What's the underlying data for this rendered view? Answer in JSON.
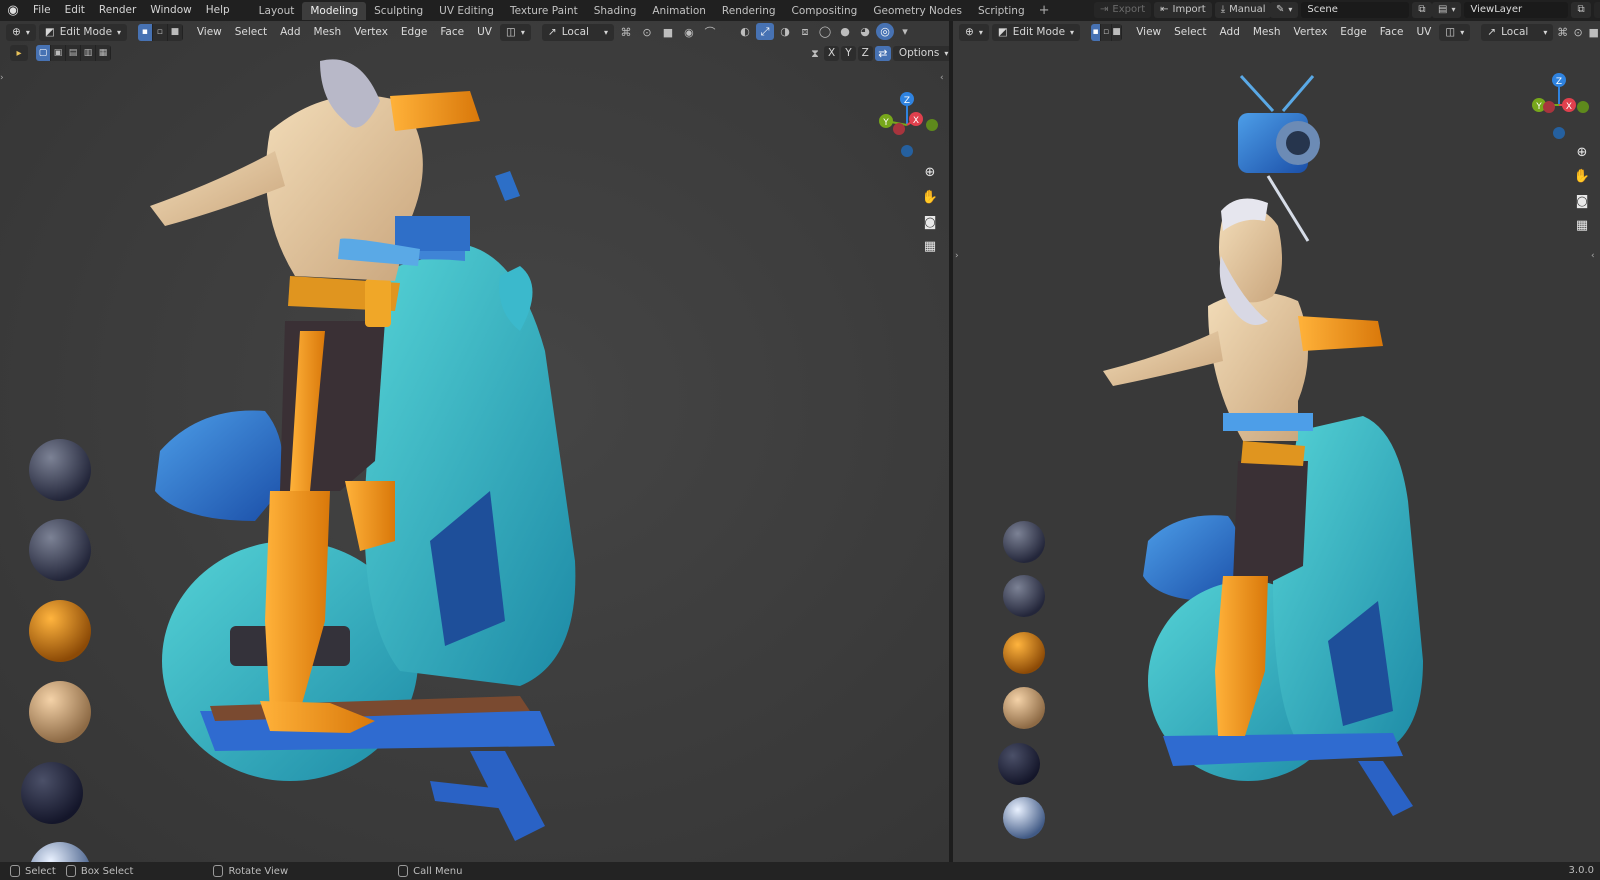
{
  "menu": [
    "File",
    "Edit",
    "Render",
    "Window",
    "Help"
  ],
  "workspaces": [
    "Layout",
    "Modeling",
    "Sculpting",
    "UV Editing",
    "Texture Paint",
    "Shading",
    "Animation",
    "Rendering",
    "Compositing",
    "Geometry Nodes",
    "Scripting"
  ],
  "active_workspace": "Modeling",
  "topbar": {
    "export": "Export",
    "import": "Import",
    "manual": "Manual",
    "scene": "Scene",
    "view_layer": "ViewLayer"
  },
  "left_view": {
    "mode": "Edit Mode",
    "menus": [
      "View",
      "Select",
      "Add",
      "Mesh",
      "Vertex",
      "Edge",
      "Face",
      "UV"
    ],
    "orientation": "Local",
    "axes": [
      "X",
      "Y",
      "Z"
    ],
    "options": "Options"
  },
  "right_view": {
    "mode": "Edit Mode",
    "menus": [
      "View",
      "Select",
      "Add",
      "Mesh",
      "Vertex",
      "Edge",
      "Face",
      "UV"
    ],
    "orientation": "Local"
  },
  "gizmo": {
    "z": "Z",
    "y": "Y",
    "x": "X"
  },
  "status": {
    "select": "Select",
    "box_select": "Box Select",
    "rotate_view": "Rotate View",
    "call_menu": "Call Menu",
    "version": "3.0.0"
  },
  "colors": {
    "accent": "#4772b3",
    "viewport_bg": "#3a3a3a",
    "axis_x": "#e0404d",
    "axis_y": "#77a71b",
    "axis_z": "#2f83e0"
  }
}
